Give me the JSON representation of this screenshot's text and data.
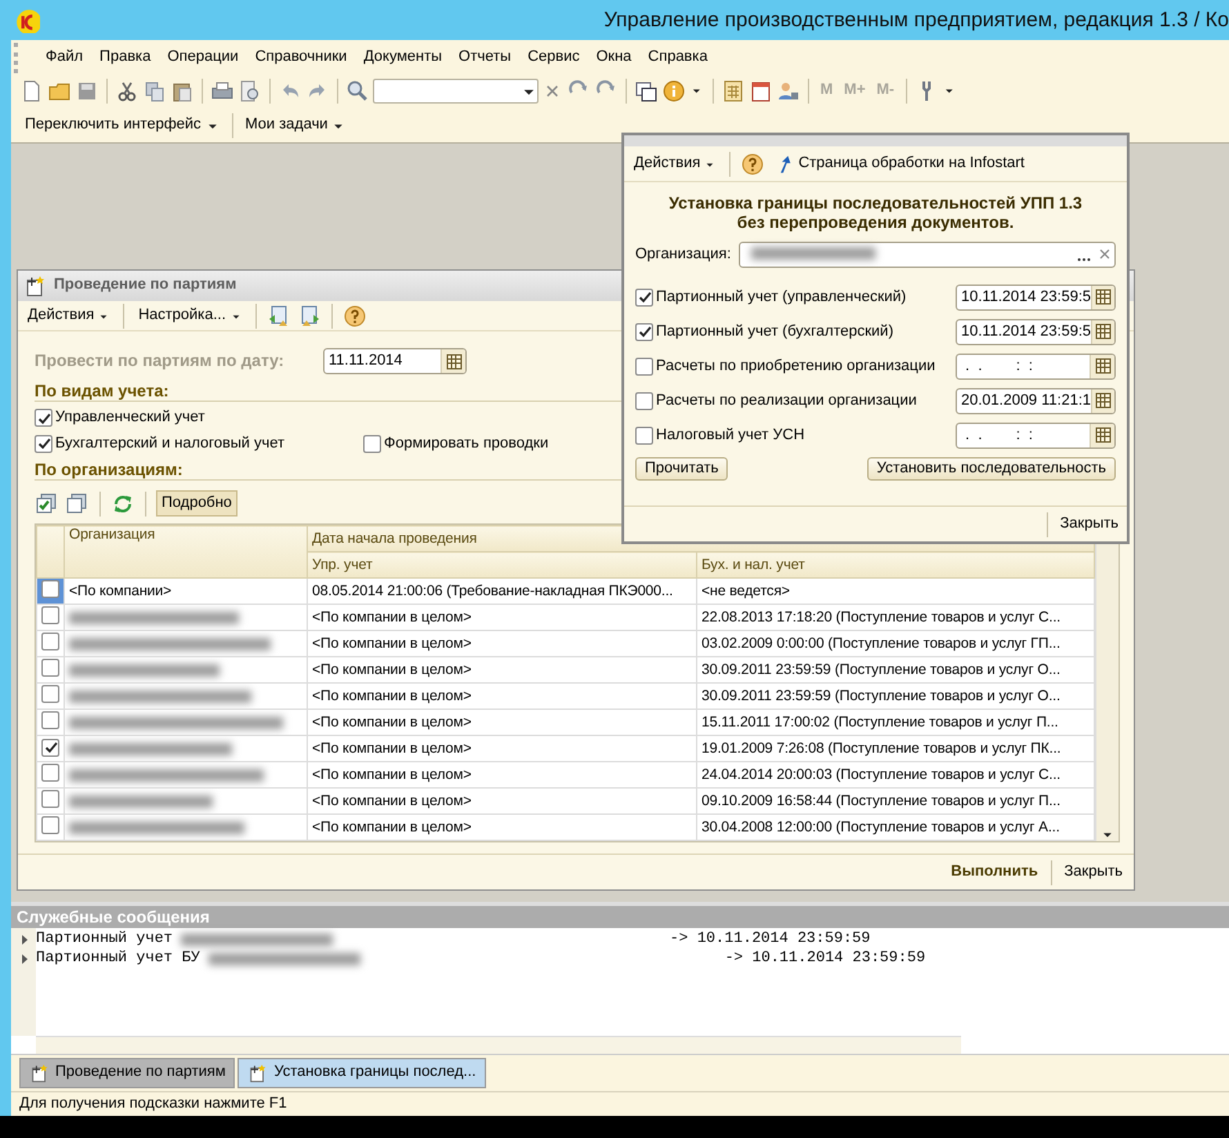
{
  "window": {
    "title": "Управление производственным предприятием, редакция 1.3 / Ко"
  },
  "menu": [
    "Файл",
    "Правка",
    "Операции",
    "Справочники",
    "Документы",
    "Отчеты",
    "Сервис",
    "Окна",
    "Справка"
  ],
  "memory_buttons": [
    {
      "label": "M",
      "disabled": true
    },
    {
      "label": "M+",
      "disabled": true
    },
    {
      "label": "M-",
      "disabled": true
    }
  ],
  "panel_buttons": [
    "Переключить интерфейс",
    "Мои задачи"
  ],
  "processing_window": {
    "title": "Проведение по партиям",
    "toolbar": [
      "Действия",
      "Настройка..."
    ],
    "date_label": "Провести по партиям по дату:",
    "date_value": "11.11.2014",
    "section_accounting": "По видам учета:",
    "options": [
      {
        "label": "Управленческий учет",
        "checked": true
      },
      {
        "label": "Бухгалтерский и налоговый учет",
        "checked": true
      },
      {
        "label": "Формировать проводки",
        "checked": false
      }
    ],
    "section_orgs": "По организациям:",
    "details_button": {
      "label": "Подробно",
      "on": true
    },
    "table": {
      "columns": [
        "Организация",
        "Дата начала проведения"
      ],
      "subcolumns": [
        "Упр. учет",
        "Бух. и нал. учет"
      ],
      "rows": [
        {
          "selected": true,
          "checked": false,
          "redacted": false,
          "organization": "<По компании>",
          "mgmt": "08.05.2014 21:00:06 (Требование-накладная ПКЭ000...",
          "acc": "<не ведется>"
        },
        {
          "selected": false,
          "checked": false,
          "redacted": true,
          "mgmt": "<По компании в целом>",
          "acc": "22.08.2013 17:18:20 (Поступление товаров и услуг С..."
        },
        {
          "selected": false,
          "checked": false,
          "redacted": true,
          "mgmt": "<По компании в целом>",
          "acc": "03.02.2009 0:00:00 (Поступление товаров и услуг ГП..."
        },
        {
          "selected": false,
          "checked": false,
          "redacted": true,
          "mgmt": "<По компании в целом>",
          "acc": "30.09.2011 23:59:59 (Поступление товаров и услуг О..."
        },
        {
          "selected": false,
          "checked": false,
          "redacted": true,
          "mgmt": "<По компании в целом>",
          "acc": "30.09.2011 23:59:59 (Поступление товаров и услуг О..."
        },
        {
          "selected": false,
          "checked": false,
          "redacted": true,
          "mgmt": "<По компании в целом>",
          "acc": "15.11.2011 17:00:02 (Поступление товаров и услуг П..."
        },
        {
          "selected": false,
          "checked": true,
          "redacted": true,
          "mgmt": "<По компании в целом>",
          "acc": "19.01.2009 7:26:08 (Поступление товаров и услуг ПК..."
        },
        {
          "selected": false,
          "checked": false,
          "redacted": true,
          "mgmt": "<По компании в целом>",
          "acc": "24.04.2014 20:00:03 (Поступление товаров и услуг С..."
        },
        {
          "selected": false,
          "checked": false,
          "redacted": true,
          "mgmt": "<По компании в целом>",
          "acc": "09.10.2009 16:58:44 (Поступление товаров и услуг П..."
        },
        {
          "selected": false,
          "checked": false,
          "redacted": true,
          "mgmt": "<По компании в целом>",
          "acc": "30.04.2008 12:00:00 (Поступление товаров и услуг А..."
        }
      ]
    },
    "footer_buttons": [
      "Выполнить",
      "Закрыть"
    ]
  },
  "sequence_dialog": {
    "toolbar": [
      "Действия",
      "Страница обработки на Infostart"
    ],
    "heading": [
      "Установка границы последовательностей УПП 1.3",
      "без перепроведения документов."
    ],
    "org_label": "Организация:",
    "rows": [
      {
        "label": "Партионный учет (управленческий)",
        "checked": true,
        "value": "10.11.2014 23:59:5"
      },
      {
        "label": "Партионный учет (бухгалтерский)",
        "checked": true,
        "value": "10.11.2014 23:59:5"
      },
      {
        "label": "Расчеты по приобретению организации",
        "checked": false,
        "value": " .  .        :  :"
      },
      {
        "label": "Расчеты по реализации организации",
        "checked": false,
        "value": "20.01.2009 11:21:1"
      },
      {
        "label": "Налоговый учет УСН",
        "checked": false,
        "value": " .  .        :  :"
      }
    ],
    "buttons": [
      "Прочитать",
      "Установить последовательность"
    ],
    "close": "Закрыть"
  },
  "messages": {
    "title": "Служебные сообщения",
    "lines": [
      {
        "text": "Партионный учет",
        "result": "-> 10.11.2014 23:59:59"
      },
      {
        "text": "Партионный учет БУ",
        "result": "-> 10.11.2014 23:59:59"
      }
    ]
  },
  "window_tabs": [
    {
      "label": "Проведение по партиям",
      "selected": false
    },
    {
      "label": "Установка границы послед...",
      "selected": true
    }
  ],
  "status_bar": "Для получения подсказки нажмите F1"
}
